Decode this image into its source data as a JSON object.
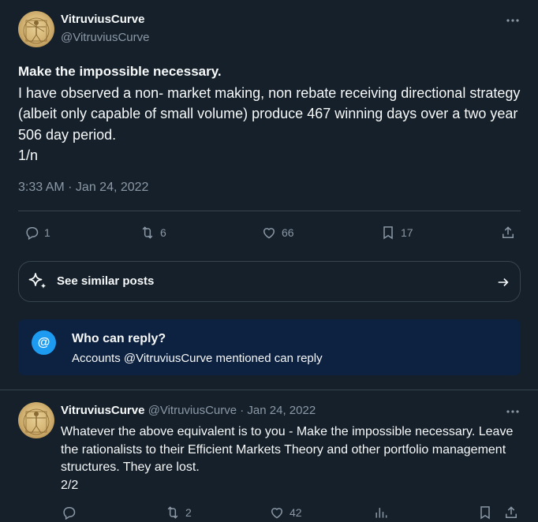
{
  "main_tweet": {
    "author_name": "VitruviusCurve",
    "author_handle": "@VitruviusCurve",
    "title_line": "Make the impossible necessary.",
    "body": "I have observed a non- market making, non rebate receiving directional strategy (albeit only capable of small volume) produce 467 winning days over a two year 506 day period.",
    "thread_marker": "1/n",
    "timestamp": "3:33 AM · Jan 24, 2022",
    "actions": {
      "replies": "1",
      "reposts": "6",
      "likes": "66",
      "bookmarks": "17"
    }
  },
  "similar_posts": {
    "label": "See similar posts"
  },
  "reply_restriction": {
    "icon_label": "@",
    "title": "Who can reply?",
    "subtitle": "Accounts @VitruviusCurve mentioned can reply"
  },
  "reply_tweet": {
    "author_name": "VitruviusCurve",
    "meta": "@VitruviusCurve · Jan 24, 2022",
    "body": "Whatever the above equivalent is to you - Make the impossible necessary. Leave the rationalists to their Efficient Markets Theory and other portfolio management structures. They are lost.",
    "thread_marker": "2/2",
    "actions": {
      "replies": "",
      "reposts": "2",
      "likes": "42"
    }
  },
  "colors": {
    "background": "#15202b",
    "muted": "#8b98a5",
    "accent": "#1d9bf0",
    "banner": "#0d2140"
  },
  "icons": [
    "more-icon",
    "reply-icon",
    "repost-icon",
    "like-icon",
    "bookmark-icon",
    "share-icon",
    "sparkle-icon",
    "arrow-right-icon",
    "at-icon",
    "views-icon"
  ]
}
